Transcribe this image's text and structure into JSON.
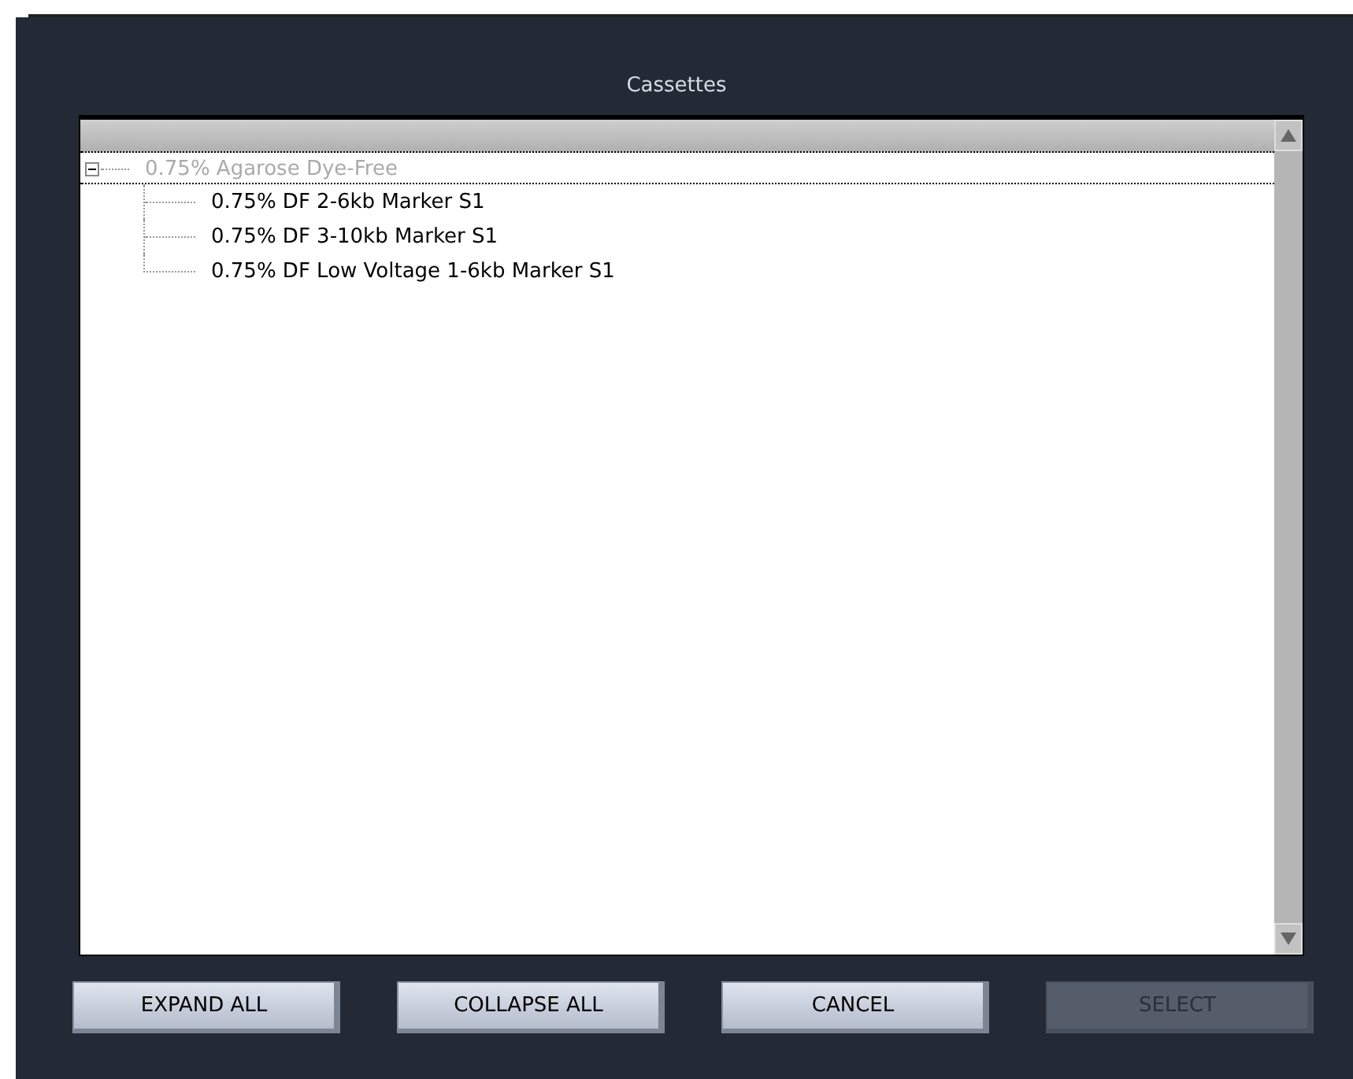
{
  "dialog": {
    "title": "Cassettes"
  },
  "tree": [
    {
      "label": "0.75% Agarose Dye-Free",
      "expanded": true,
      "disabled": true,
      "children": [
        {
          "label": "0.75% DF 2-6kb Marker S1",
          "disabled": false
        },
        {
          "label": "0.75% DF 3-10kb Marker S1",
          "disabled": false
        },
        {
          "label": "0.75% DF Low Voltage 1-6kb Marker S1",
          "disabled": false
        }
      ]
    }
  ],
  "buttons": [
    {
      "label": "EXPAND ALL",
      "disabled": false
    },
    {
      "label": "COLLAPSE ALL",
      "disabled": false
    },
    {
      "label": "CANCEL",
      "disabled": false
    },
    {
      "label": "SELECT",
      "disabled": true
    }
  ]
}
